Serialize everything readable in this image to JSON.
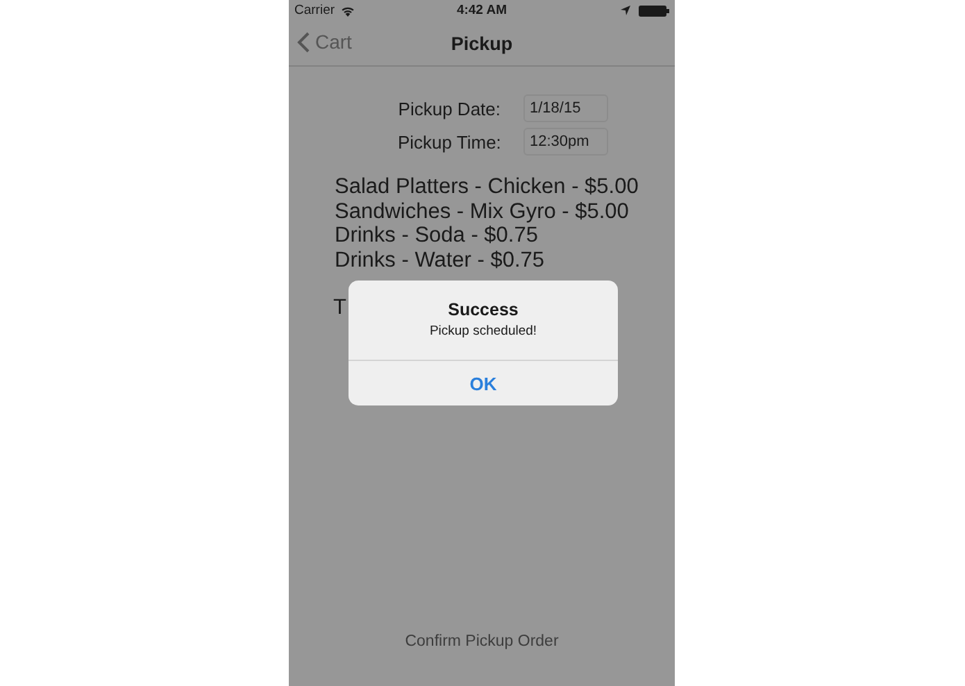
{
  "status_bar": {
    "carrier": "Carrier",
    "time": "4:42 AM"
  },
  "nav": {
    "back": "Cart",
    "title": "Pickup"
  },
  "fields": [
    {
      "label": "Pickup Date:",
      "value": "1/18/15"
    },
    {
      "label": "Pickup Time:",
      "value": "12:30pm"
    }
  ],
  "items": [
    "Salad Platters - Chicken - $5.00",
    "Sandwiches - Mix Gyro - $5.00",
    "Drinks - Soda - $0.75",
    "Drinks - Water - $0.75"
  ],
  "total": "T",
  "confirm": "Confirm Pickup Order",
  "alert": {
    "title": "Success",
    "message": "Pickup scheduled!",
    "buttons": [
      "OK"
    ]
  }
}
